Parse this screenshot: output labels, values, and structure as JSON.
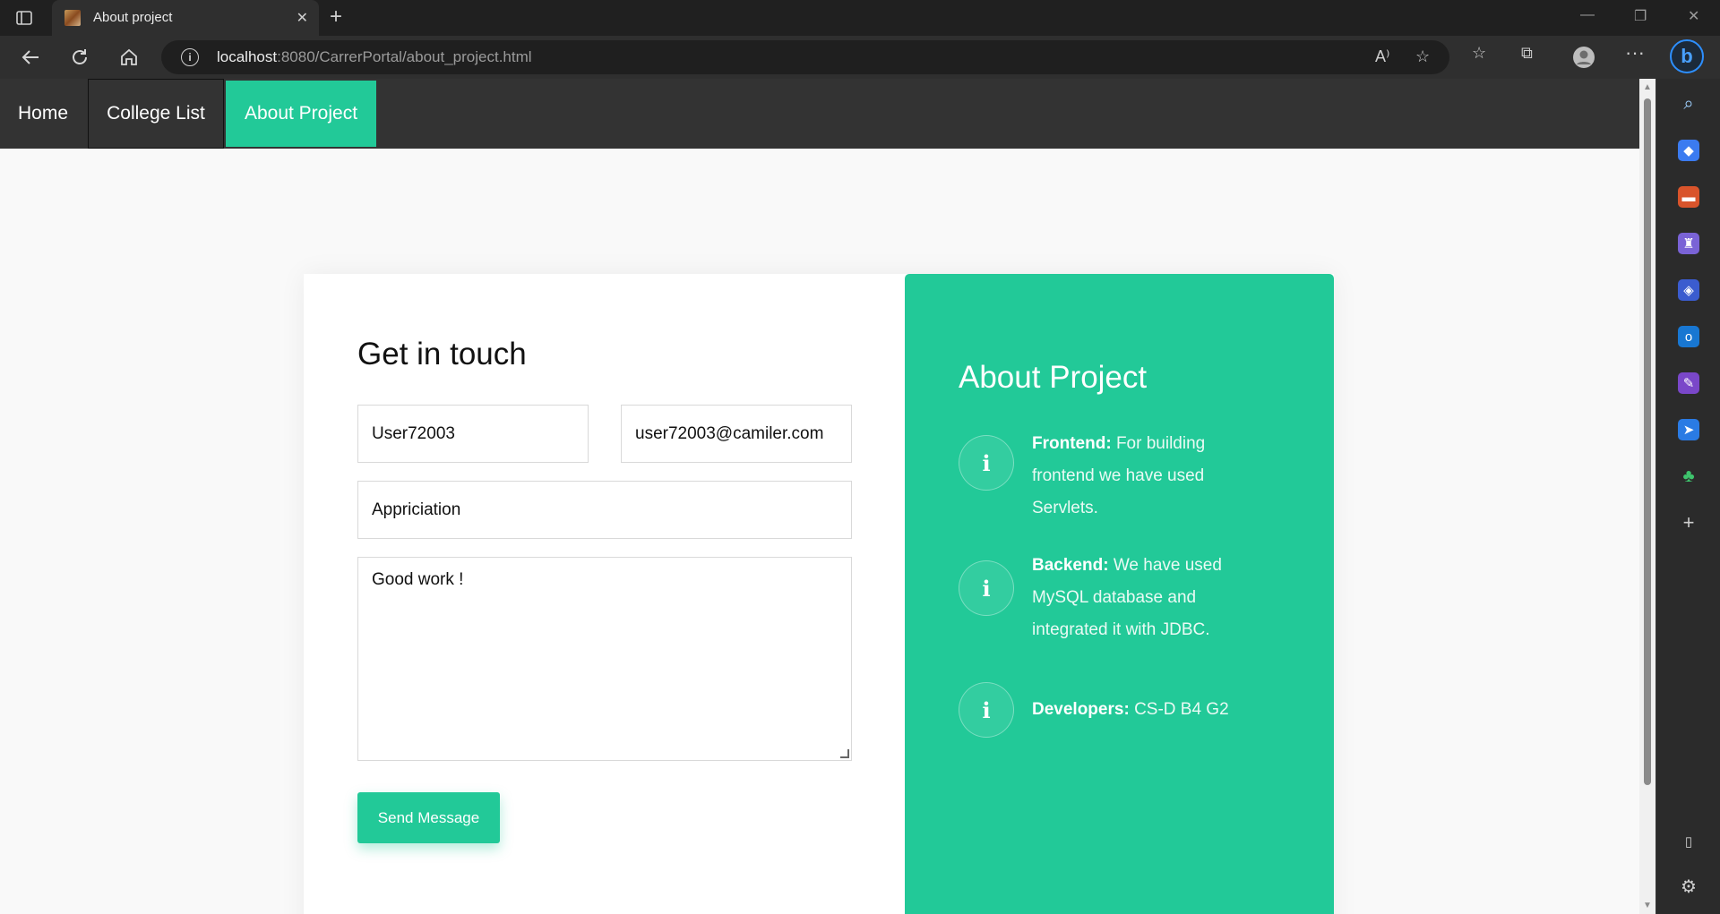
{
  "browser": {
    "tab_title": "About project",
    "tab_close": "✕",
    "new_tab": "+",
    "url_host": "localhost",
    "url_rest": ":8080/CarrerPortal/about_project.html",
    "window_controls": {
      "minimize": "—",
      "restore": "❐",
      "close": "✕"
    }
  },
  "site_nav": {
    "items": [
      {
        "label": "Home"
      },
      {
        "label": "College List"
      },
      {
        "label": "About Project",
        "active": true
      }
    ]
  },
  "form": {
    "title": "Get in touch",
    "name_value": "User72003",
    "email_value": "user72003@camiler.com",
    "subject_value": "Appriciation",
    "message_value": "Good work !",
    "send_label": "Send Message"
  },
  "about": {
    "title": "About Project",
    "items": [
      {
        "label": "Frontend:",
        "text": "For building frontend we have used Servlets.",
        "icon": "info-icon"
      },
      {
        "label": "Backend:",
        "text": "We have used MySQL database and integrated it with JDBC.",
        "icon": "info-icon"
      },
      {
        "label": "Developers:",
        "text": "CS-D B4 G2",
        "icon": "info-icon"
      }
    ]
  },
  "colors": {
    "accent": "#22c998",
    "nav_bg": "#333333",
    "page_bg": "#f9f9f9"
  }
}
